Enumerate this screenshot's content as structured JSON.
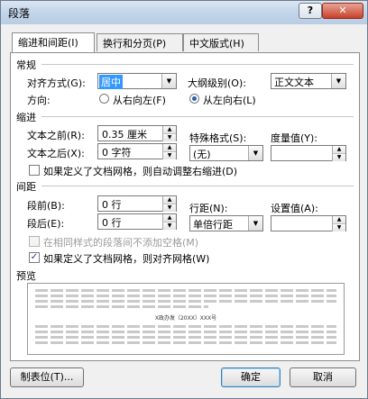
{
  "window": {
    "title": "段落",
    "help": "?",
    "close": "✕"
  },
  "tabs": [
    "缩进和间距(I)",
    "换行和分页(P)",
    "中文版式(H)"
  ],
  "general": {
    "section": "常规",
    "align_label": "对齐方式(G):",
    "align_value": "居中",
    "outline_label": "大纲级别(O):",
    "outline_value": "正文文本",
    "direction_label": "方向:",
    "rtl_label": "从右向左(F)",
    "ltr_label": "从左向右(L)"
  },
  "indent": {
    "section": "缩进",
    "before_label": "文本之前(R):",
    "before_value": "0.35 厘米",
    "after_label": "文本之后(X):",
    "after_value": "0 字符",
    "special_label": "特殊格式(S):",
    "special_value": "(无)",
    "measure_label": "度量值(Y):",
    "measure_value": "",
    "auto_adjust_label": "如果定义了文档网格，则自动调整右缩进(D)"
  },
  "spacing": {
    "section": "间距",
    "before_label": "段前(B):",
    "before_value": "0 行",
    "after_label": "段后(E):",
    "after_value": "0 行",
    "line_label": "行距(N):",
    "line_value": "单倍行距",
    "setting_label": "设置值(A):",
    "setting_value": "",
    "no_space_label": "在相同样式的段落间不添加空格(M)",
    "snap_grid_label": "如果定义了文档网格，则对齐网格(W)"
  },
  "preview": {
    "section": "预览",
    "sample_text": "X政办发〔20XX〕XXX号"
  },
  "buttons": {
    "tabs": "制表位(T)...",
    "ok": "确定",
    "cancel": "取消"
  },
  "checkmark": "✓"
}
